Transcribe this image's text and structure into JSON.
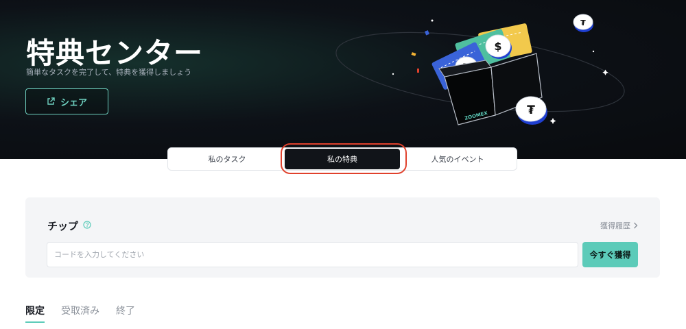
{
  "hero": {
    "title": "特典センター",
    "subtitle": "簡単なタスクを完了して、特典を獲得しましょう",
    "share_label": "シェア",
    "brand_text": "ZOOMEX"
  },
  "tabs": [
    {
      "label": "私のタスク",
      "active": false
    },
    {
      "label": "私の特典",
      "active": true
    },
    {
      "label": "人気のイベント",
      "active": false
    }
  ],
  "chip": {
    "title": "チップ",
    "history_label": "獲得履歴",
    "input_placeholder": "コードを入力してください",
    "input_value": "",
    "claim_label": "今すぐ獲得"
  },
  "sub_tabs": [
    {
      "label": "限定",
      "active": true
    },
    {
      "label": "受取済み",
      "active": false
    },
    {
      "label": "終了",
      "active": false
    }
  ],
  "colors": {
    "accent": "#5ccbb9",
    "hero_bg": "#0d1117",
    "highlight": "#e0412c"
  },
  "icons": {
    "share": "external-link-icon",
    "help": "question-circle-icon",
    "history": "chevron-right-icon"
  }
}
